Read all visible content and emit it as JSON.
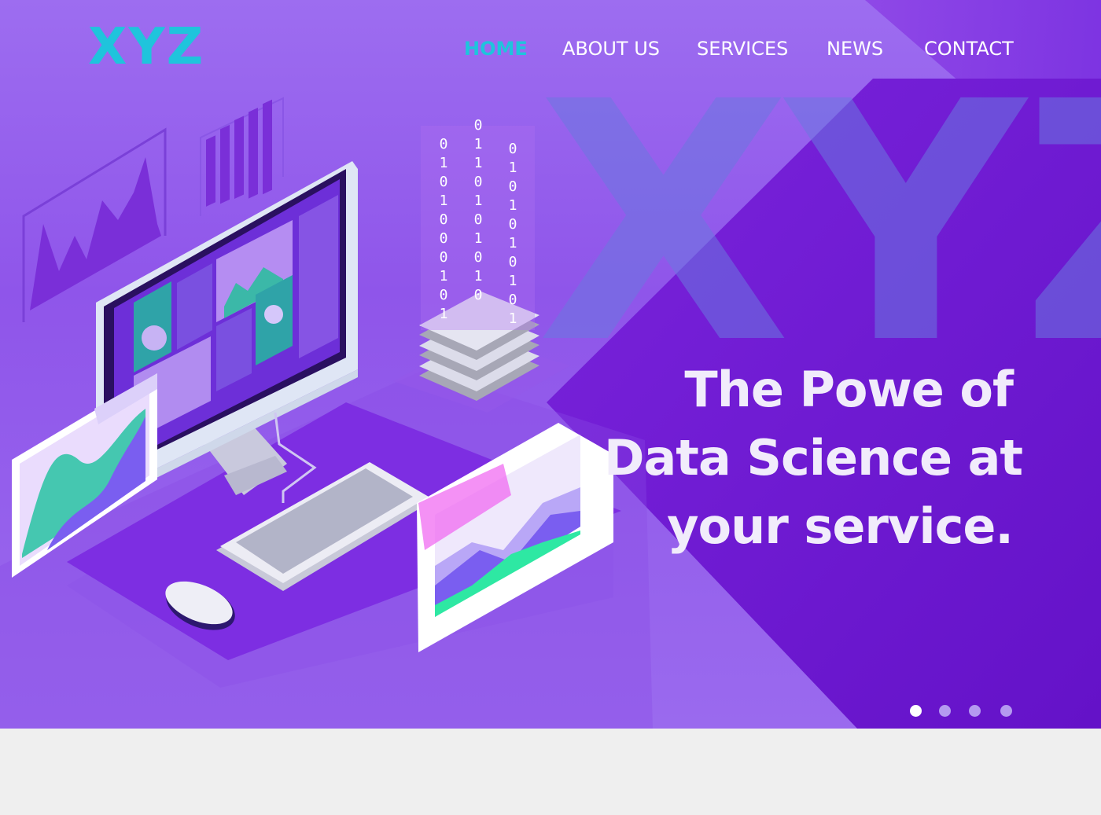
{
  "brand": {
    "logo": "XYZ",
    "watermark": "XYZ"
  },
  "nav": {
    "items": [
      {
        "label": "HOME",
        "active": true
      },
      {
        "label": "ABOUT US",
        "active": false
      },
      {
        "label": "SERVICES",
        "active": false
      },
      {
        "label": "NEWS",
        "active": false
      },
      {
        "label": "CONTACT",
        "active": false
      }
    ]
  },
  "hero": {
    "headline_lines": [
      "The Powe of",
      "Data Science at",
      "your service."
    ],
    "slides": {
      "count": 4,
      "active_index": 0
    }
  },
  "binary_columns": [
    "0101000101",
    "0110101010",
    "0101010101"
  ],
  "colors": {
    "accent": "#1fc4dc",
    "hero_dark": "#6a12cc",
    "hero_light": "#9d6df0",
    "text_light": "#f1ecfb",
    "page_bg": "#efefef"
  }
}
